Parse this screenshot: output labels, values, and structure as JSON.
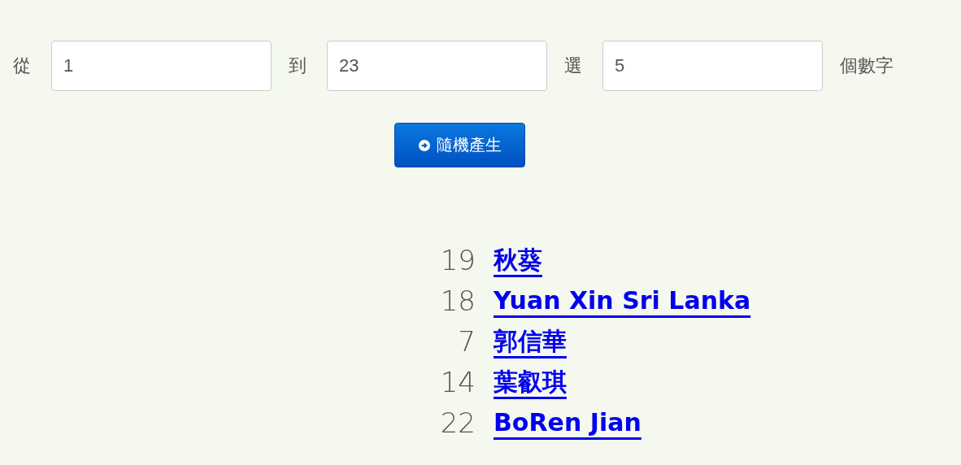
{
  "form": {
    "from_label": "從",
    "from_value": "1",
    "to_label": "到",
    "to_value": "23",
    "pick_label": "選",
    "pick_value": "5",
    "suffix": "個數字"
  },
  "generate_button": {
    "label": "隨機產生"
  },
  "results": [
    {
      "number": "19",
      "name": "秋葵"
    },
    {
      "number": "18",
      "name": "Yuan Xin Sri Lanka"
    },
    {
      "number": "7",
      "name": "郭信華"
    },
    {
      "number": "14",
      "name": "葉叡琪"
    },
    {
      "number": "22",
      "name": "BoRen Jian"
    }
  ]
}
